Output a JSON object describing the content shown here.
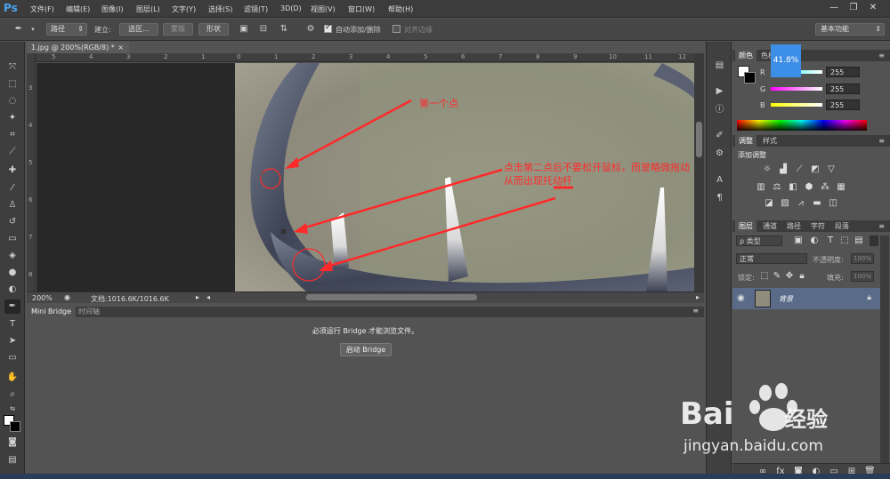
{
  "app": {
    "logo": "Ps",
    "menus": [
      "文件(F)",
      "编辑(E)",
      "图像(I)",
      "图层(L)",
      "文字(Y)",
      "选择(S)",
      "滤镜(T)",
      "3D(D)",
      "视图(V)",
      "窗口(W)",
      "帮助(H)"
    ],
    "window_controls": {
      "minimize": "—",
      "restore": "❐",
      "close": "✕"
    }
  },
  "options_bar": {
    "mode_select": "路径",
    "build_label": "建立:",
    "selection_btn": "选区...",
    "mask_btn": "蒙版",
    "shape_btn": "形状",
    "auto_add_delete": "自动添加/删除",
    "align_edges": "对齐边缘",
    "workspace": "基本功能"
  },
  "document": {
    "tab_title": "1.jpg @ 200%(RGB/8) *",
    "tab_close": "×",
    "ruler_top_ticks": [
      "5",
      "4",
      "3",
      "2",
      "1",
      "0",
      "1",
      "2",
      "3",
      "4",
      "5",
      "6",
      "7",
      "8",
      "9",
      "10",
      "11",
      "12"
    ],
    "ruler_left_ticks": [
      "3",
      "4",
      "5",
      "6",
      "7",
      "8"
    ],
    "zoom": "200%",
    "doc_info": "文档:1016.6K/1016.6K",
    "annotation_1": "第一个点",
    "annotation_2_line1": "点击第二点后不要松开鼠标，而是略微拖动",
    "annotation_2_line2": "从而出现托动杆"
  },
  "bridge": {
    "tabs": [
      "Mini Bridge",
      "时间轴"
    ],
    "message": "必须运行 Bridge 才能浏览文件。",
    "launch_button": "启动 Bridge"
  },
  "color_panel": {
    "tabs": [
      "颜色",
      "色板"
    ],
    "channels": [
      {
        "label": "R",
        "value": "255"
      },
      {
        "label": "G",
        "value": "255"
      },
      {
        "label": "B",
        "value": "255"
      }
    ]
  },
  "zoom_badge": "41.8%",
  "adjustments_panel": {
    "tabs": [
      "调整",
      "样式"
    ],
    "title": "添加调整"
  },
  "layers_panel": {
    "tabs": [
      "图层",
      "通道",
      "路径",
      "字符",
      "段落"
    ],
    "filter_kind": "ρ 类型",
    "blend_mode": "正常",
    "opacity_label": "不透明度:",
    "opacity_value": "100%",
    "lock_label": "锁定:",
    "fill_label": "填充:",
    "fill_value": "100%",
    "layer_name": "背景"
  },
  "watermark": {
    "brand": "Bai",
    "brand_suffix": "经验",
    "url": "jingyan.baidu.com"
  },
  "colors": {
    "accent": "#3d8ee6",
    "annotation_red": "#ff2a2a",
    "layer_selected": "#596b88"
  }
}
